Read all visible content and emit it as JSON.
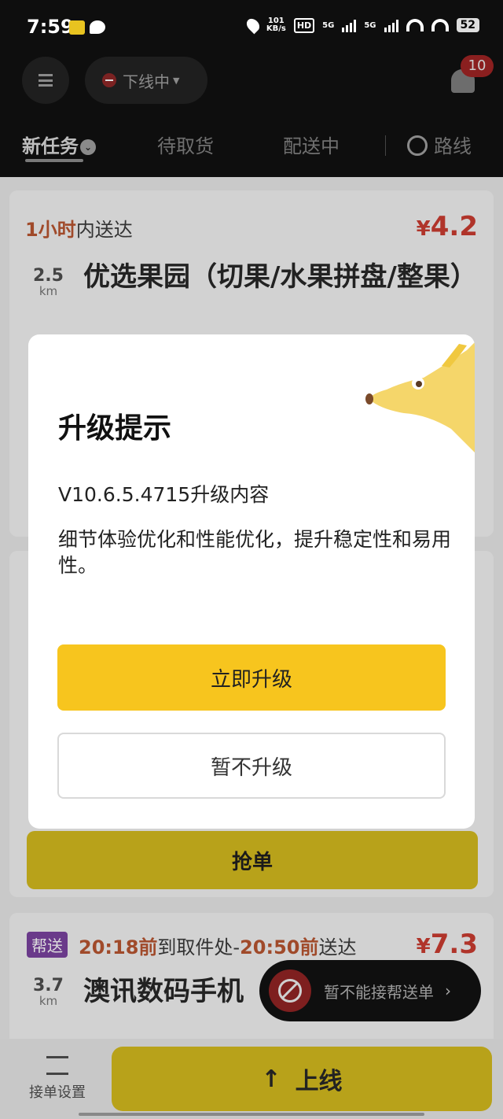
{
  "status_bar": {
    "time": "7:59",
    "net_speed_value": "101",
    "net_speed_unit": "KB/s",
    "hd": "HD",
    "sim1": "5G",
    "sim2": "5G",
    "battery": "52"
  },
  "header": {
    "status_label": "下线中",
    "notification_count": "10"
  },
  "tabs": [
    {
      "label": "新任务",
      "active": true
    },
    {
      "label": "待取货",
      "active": false
    },
    {
      "label": "配送中",
      "active": false
    },
    {
      "label": "路线",
      "active": false
    }
  ],
  "orders": [
    {
      "eta_highlight": "1小时",
      "eta_rest": "内送达",
      "price_symbol": "¥",
      "price": "4.2",
      "distance": "2.5",
      "distance_unit": "km",
      "shop": "优选果园（切果/水果拼盘/整果）"
    },
    {
      "grab_label": "抢单"
    },
    {
      "tag": "帮送",
      "pickup_time": "20:18前",
      "pickup_text": "到取件处-",
      "deliver_time": "20:50前",
      "deliver_text": "送达",
      "price_symbol": "¥",
      "price": "7.3",
      "distance": "3.7",
      "distance_unit": "km",
      "shop": "澳讯数码手机"
    }
  ],
  "toast": {
    "text": "暂不能接帮送单",
    "arrow": "›"
  },
  "bottom_bar": {
    "settings_label": "接单设置",
    "online_arrow": "↑",
    "online_label": "上线"
  },
  "modal": {
    "title": "升级提示",
    "version_line": "V10.6.5.4715升级内容",
    "description": "细节体验优化和性能优化，提升稳定性和易用性。",
    "upgrade_button": "立即升级",
    "later_button": "暂不升级"
  },
  "colors": {
    "accent_yellow": "#f7c51e",
    "price_red": "#e24a3b",
    "eta_orange": "#f06c2c",
    "tag_purple": "#8b4bbd"
  }
}
